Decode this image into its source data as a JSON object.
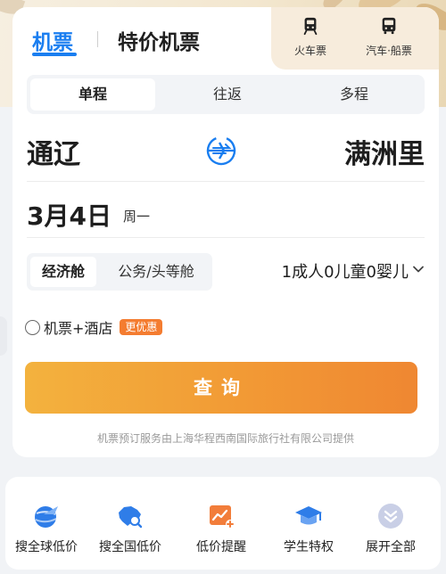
{
  "tabs": {
    "flight": "机票",
    "special": "特价机票"
  },
  "side_tabs": [
    {
      "label": "火车票",
      "icon": "train-icon"
    },
    {
      "label": "汽车·船票",
      "icon": "bus-icon"
    }
  ],
  "trip_types": [
    "单程",
    "往返",
    "多程"
  ],
  "route": {
    "from": "通辽",
    "to": "满洲里"
  },
  "date": {
    "day": "3月4日",
    "weekday": "周一"
  },
  "cabin": {
    "economy": "经济舱",
    "business": "公务/头等舱"
  },
  "passengers": "1成人0儿童0婴儿",
  "combo": {
    "label": "机票+酒店",
    "badge": "更优惠"
  },
  "search_button": "查询",
  "provider_note": "机票预订服务由上海华程西南国际旅行社有限公司提供",
  "quick_links": [
    {
      "label": "搜全球低价",
      "icon": "globe-plane-icon"
    },
    {
      "label": "搜全国低价",
      "icon": "china-map-search-icon"
    },
    {
      "label": "低价提醒",
      "icon": "price-alert-chart-icon"
    },
    {
      "label": "学生特权",
      "icon": "graduation-cap-icon"
    },
    {
      "label": "展开全部",
      "icon": "expand-chevrons-icon"
    }
  ],
  "colors": {
    "accent_blue": "#1a7ef0",
    "search_orange": "#f29a35",
    "badge_orange": "#f47c30"
  }
}
